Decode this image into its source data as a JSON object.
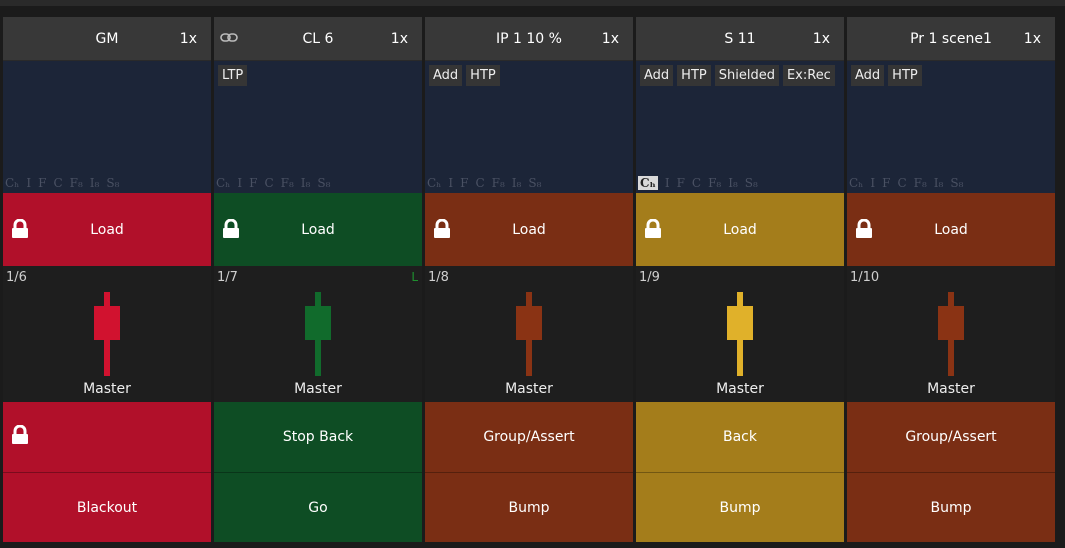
{
  "colors": {
    "red": "#b1102a",
    "green": "#0e4d24",
    "brown": "#7a2e14",
    "gold": "#a47d1b",
    "fader_red": "#d1122f",
    "fader_green": "#116b2c",
    "fader_brown": "#8a3314",
    "fader_gold": "#e0b12a"
  },
  "faders": [
    {
      "header": {
        "title": "GM",
        "speed": "1x",
        "linked": false
      },
      "tags": [],
      "channel_flags": [
        "Cₕ",
        "I",
        "F",
        "C",
        "F₈",
        "I₈",
        "S₈"
      ],
      "active_flag": "",
      "load_label": "Load",
      "fader_number": "1/6",
      "fader_label": "Master",
      "ltp_mark": "",
      "button1": "",
      "button1_locked": true,
      "button2": "Blackout",
      "theme": "red"
    },
    {
      "header": {
        "title": "CL 6",
        "speed": "1x",
        "linked": true
      },
      "tags": [
        "LTP"
      ],
      "channel_flags": [
        "Cₕ",
        "I",
        "F",
        "C",
        "F₈",
        "I₈",
        "S₈"
      ],
      "active_flag": "",
      "load_label": "Load",
      "fader_number": "1/7",
      "fader_label": "Master",
      "ltp_mark": "L",
      "button1": "Stop Back",
      "button1_locked": false,
      "button2": "Go",
      "theme": "green"
    },
    {
      "header": {
        "title": "IP 1  10 %",
        "speed": "1x",
        "linked": false
      },
      "tags": [
        "Add",
        "HTP"
      ],
      "channel_flags": [
        "Cₕ",
        "I",
        "F",
        "C",
        "F₈",
        "I₈",
        "S₈"
      ],
      "active_flag": "",
      "load_label": "Load",
      "fader_number": "1/8",
      "fader_label": "Master",
      "ltp_mark": "",
      "button1": "Group/Assert",
      "button1_locked": false,
      "button2": "Bump",
      "theme": "brown"
    },
    {
      "header": {
        "title": "S 11",
        "speed": "1x",
        "linked": false
      },
      "tags": [
        "Add",
        "HTP",
        "Shielded",
        "Ex:Rec"
      ],
      "channel_flags": [
        "Cₕ",
        "I",
        "F",
        "C",
        "F₈",
        "I₈",
        "S₈"
      ],
      "active_flag": "Cₕ",
      "load_label": "Load",
      "fader_number": "1/9",
      "fader_label": "Master",
      "ltp_mark": "",
      "button1": "Back",
      "button1_locked": false,
      "button2": "Bump",
      "theme": "gold"
    },
    {
      "header": {
        "title": "Pr 1  scene1",
        "speed": "1x",
        "linked": false
      },
      "tags": [
        "Add",
        "HTP"
      ],
      "channel_flags": [
        "Cₕ",
        "I",
        "F",
        "C",
        "F₈",
        "I₈",
        "S₈"
      ],
      "active_flag": "",
      "load_label": "Load",
      "fader_number": "1/10",
      "fader_label": "Master",
      "ltp_mark": "",
      "button1": "Group/Assert",
      "button1_locked": false,
      "button2": "Bump",
      "theme": "brown"
    }
  ]
}
